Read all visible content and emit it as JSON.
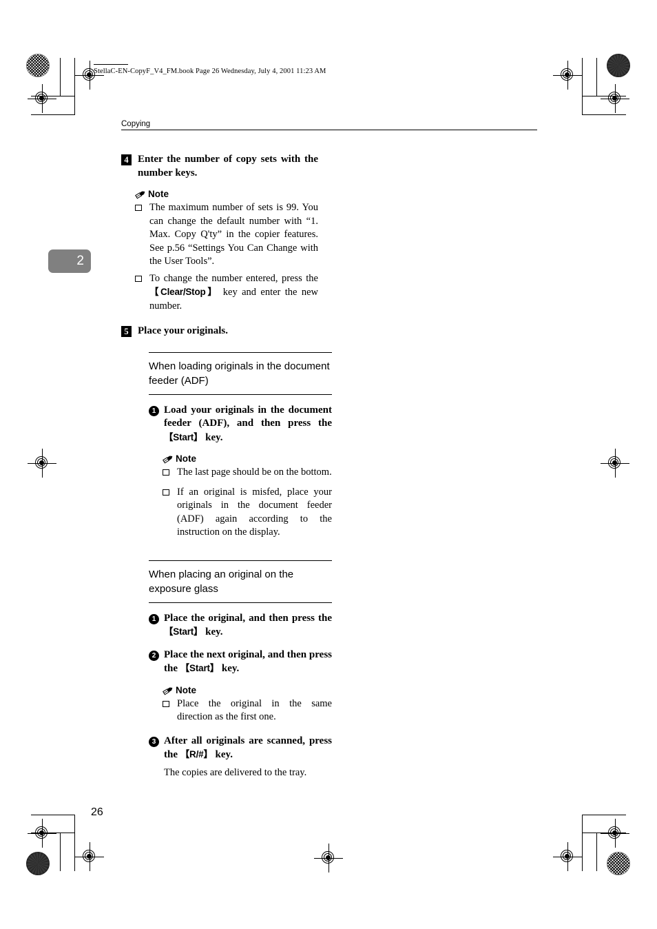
{
  "document": {
    "file_header": "StellaC-EN-CopyF_V4_FM.book  Page 26  Wednesday, July 4, 2001  11:23 AM",
    "running_head": "Copying",
    "chapter_tab": "2",
    "page_number": "26"
  },
  "steps": [
    {
      "number": "4",
      "text": "Enter the number of copy sets with the number keys.",
      "note_label": "Note",
      "notes": [
        "The maximum number of sets is 99. You can change the default number with “1. Max. Copy Q'ty” in the copier features. See p.56 “Settings You Can Change with the User Tools”.",
        {
          "before": "To change the number entered, press the ",
          "key": "【Clear/Stop】",
          "after": " key and enter the new number."
        }
      ]
    },
    {
      "number": "5",
      "text": "Place your originals."
    }
  ],
  "sections": [
    {
      "title": "When loading originals in the document feeder (ADF)",
      "substeps": [
        {
          "number": "1",
          "before": "Load your originals in the document feeder (ADF), and then press the ",
          "key": "【Start】",
          "after": " key."
        }
      ],
      "note_label": "Note",
      "notes": [
        "The last page should be on the bottom.",
        "If an original is misfed, place your originals in the document feeder (ADF) again according to the instruction on the display."
      ]
    },
    {
      "title": "When placing an original on the exposure glass",
      "substeps": [
        {
          "number": "1",
          "before": "Place the original, and then press the ",
          "key": "【Start】",
          "after": " key."
        },
        {
          "number": "2",
          "before": "Place the next original, and then press the ",
          "key": "【Start】",
          "after": " key."
        },
        {
          "number": "3",
          "before": "After all originals are scanned, press the ",
          "key": "【R/#】",
          "after": " key."
        }
      ],
      "note_label": "Note",
      "notes": [
        "Place the original in the same direction as the first one."
      ],
      "closing_para": "The copies are delivered to the tray."
    }
  ],
  "icons": {
    "pencil": "pencil-icon",
    "box_bullet": "box-bullet-icon",
    "registration_target": "registration-target-icon",
    "density_patch": "density-patch-icon"
  }
}
